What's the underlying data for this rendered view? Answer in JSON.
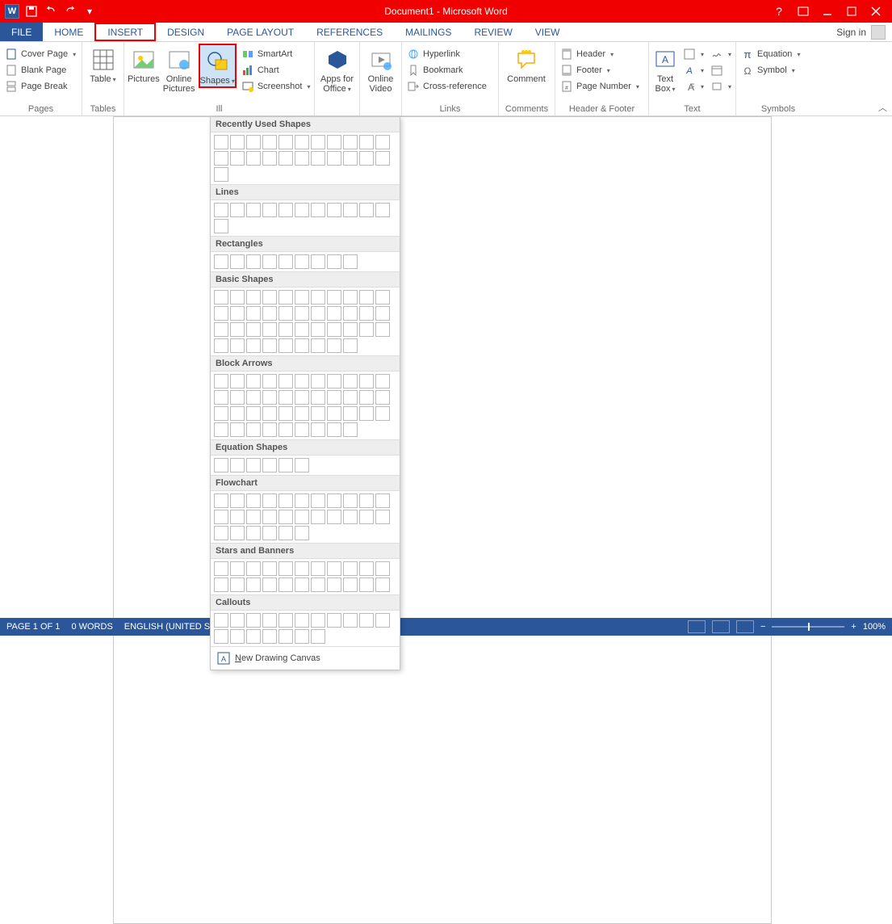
{
  "titlebar": {
    "app_letter": "W",
    "title": "Document1 -  Microsoft Word"
  },
  "tabs": {
    "file": "FILE",
    "items": [
      "HOME",
      "INSERT",
      "DESIGN",
      "PAGE LAYOUT",
      "REFERENCES",
      "MAILINGS",
      "REVIEW",
      "VIEW"
    ],
    "active_index": 1,
    "signin": "Sign in"
  },
  "ribbon": {
    "pages": {
      "cover_page": "Cover Page",
      "blank_page": "Blank Page",
      "page_break": "Page Break",
      "label": "Pages"
    },
    "tables": {
      "table": "Table",
      "label": "Tables"
    },
    "illustrations": {
      "pictures": "Pictures",
      "online_pictures_line1": "Online",
      "online_pictures_line2": "Pictures",
      "shapes": "Shapes",
      "smartart": "SmartArt",
      "chart": "Chart",
      "screenshot": "Screenshot",
      "label": "Ill"
    },
    "apps": {
      "apps_line1": "Apps for",
      "apps_line2": "Office",
      "label": ""
    },
    "media": {
      "online_video_line1": "Online",
      "online_video_line2": "Video",
      "label": ""
    },
    "links": {
      "hyperlink": "Hyperlink",
      "bookmark": "Bookmark",
      "crossref": "Cross-reference",
      "label": "Links"
    },
    "comments": {
      "comment": "Comment",
      "label": "Comments"
    },
    "headerfooter": {
      "header": "Header",
      "footer": "Footer",
      "page_number": "Page Number",
      "label": "Header & Footer"
    },
    "text": {
      "textbox_line1": "Text",
      "textbox_line2": "Box",
      "label": "Text"
    },
    "symbols": {
      "equation": "Equation",
      "symbol": "Symbol",
      "label": "Symbols"
    }
  },
  "shapes_menu": {
    "categories": [
      {
        "name": "Recently Used Shapes",
        "count": 23
      },
      {
        "name": "Lines",
        "count": 12
      },
      {
        "name": "Rectangles",
        "count": 9
      },
      {
        "name": "Basic Shapes",
        "count": 42
      },
      {
        "name": "Block Arrows",
        "count": 42
      },
      {
        "name": "Equation Shapes",
        "count": 6
      },
      {
        "name": "Flowchart",
        "count": 28
      },
      {
        "name": "Stars and Banners",
        "count": 22
      },
      {
        "name": "Callouts",
        "count": 18
      }
    ],
    "footer": "New Drawing Canvas",
    "footer_accel": "N"
  },
  "statusbar": {
    "page": "PAGE 1 OF 1",
    "words": "0 WORDS",
    "lang": "ENGLISH (UNITED STATES)",
    "zoom": "100%"
  }
}
